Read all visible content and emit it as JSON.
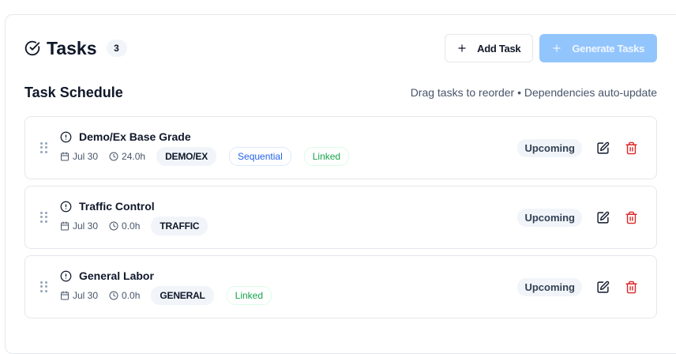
{
  "header": {
    "title": "Tasks",
    "count": "3",
    "add_label": "Add Task",
    "generate_label": "Generate Tasks"
  },
  "section": {
    "title": "Task Schedule",
    "hint": "Drag tasks to reorder • Dependencies auto-update"
  },
  "tasks": [
    {
      "name": "Demo/Ex Base Grade",
      "date": "Jul 30",
      "duration": "24.0h",
      "category": "DEMO/EX",
      "tags": [
        "Sequential",
        "Linked"
      ],
      "status": "Upcoming"
    },
    {
      "name": "Traffic Control",
      "date": "Jul 30",
      "duration": "0.0h",
      "category": "TRAFFIC",
      "tags": [],
      "status": "Upcoming"
    },
    {
      "name": "General Labor",
      "date": "Jul 30",
      "duration": "0.0h",
      "category": "GENERAL",
      "tags": [
        "Linked"
      ],
      "status": "Upcoming"
    }
  ],
  "colors": {
    "primary_disabled": "#93c5fd",
    "sequential": "#2563eb",
    "linked": "#16a34a",
    "delete": "#dc2626"
  },
  "icons": {
    "title": "check-circle-icon",
    "add": "plus-icon",
    "task": "alert-circle-icon",
    "date": "calendar-icon",
    "duration": "clock-icon",
    "edit": "edit-icon",
    "delete": "trash-icon",
    "drag": "grip-vertical-icon"
  }
}
